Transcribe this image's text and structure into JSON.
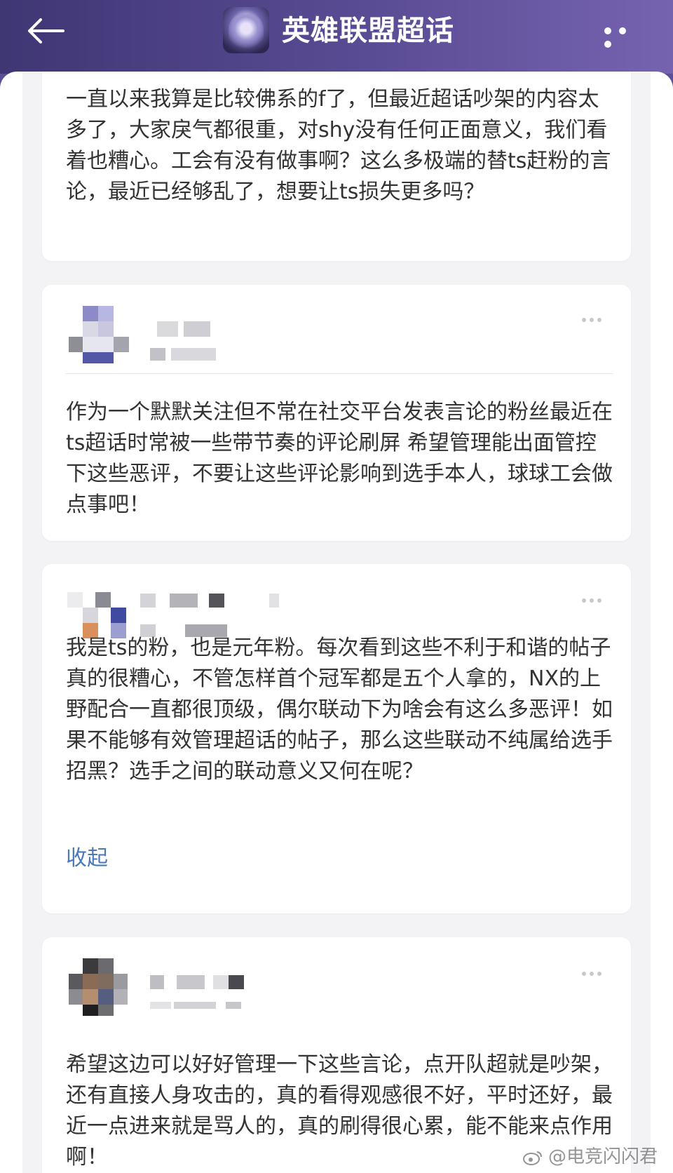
{
  "header": {
    "title": "英雄联盟超话",
    "back_icon": "arrow-left-icon",
    "more_icon": "more-dots-icon"
  },
  "posts": [
    {
      "text": "一直以来我算是比较佛系的f了，但最近超话吵架的内容太多了，大家戾气都很重，对shy没有任何正面意义，我们看着也糟心。工会有没有做事啊？这么多极端的替ts赶粉的言论，最近已经够乱了，想要让ts损失更多吗？"
    },
    {
      "text": "作为一个默默关注但不常在社交平台发表言论的粉丝最近在ts超话时常被一些带节奏的评论刷屏 希望管理能出面管控下这些恶评，不要让这些评论影响到选手本人，球球工会做点事吧！"
    },
    {
      "text": "我是ts的粉，也是元年粉。每次看到这些不利于和谐的帖子真的很糟心，不管怎样首个冠军都是五个人拿的，NX的上野配合一直都很顶级，偶尔联动下为啥会有这么多恶评！如果不能够有效管理超话的帖子，那么这些联动不纯属给选手招黑？选手之间的联动意义又何在呢？",
      "collapse_label": "收起"
    },
    {
      "text": "希望这边可以好好管理一下这些言论，点开队超就是吵架，还有直接人身攻击的，真的看得观感很不好，平时还好，最近一点进来就是骂人的，真的刷得很心累，能不能来点作用啊！"
    }
  ],
  "watermark": "@电竞闪闪君"
}
